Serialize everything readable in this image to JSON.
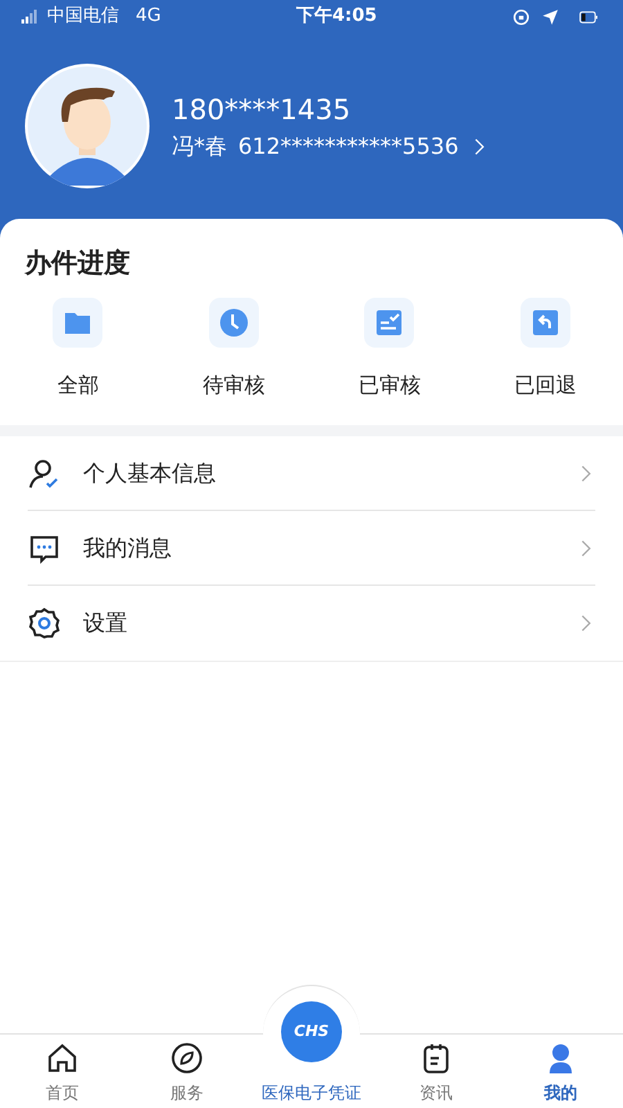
{
  "status_bar": {
    "carrier": "中国电信",
    "network": "4G",
    "time": "下午4:05"
  },
  "profile": {
    "phone": "180****1435",
    "name": "冯*春",
    "id_number": "612***********5536"
  },
  "progress": {
    "title": "办件进度",
    "items": [
      {
        "label": "全部",
        "kind": "folder"
      },
      {
        "label": "待审核",
        "kind": "clock"
      },
      {
        "label": "已审核",
        "kind": "checked"
      },
      {
        "label": "已回退",
        "kind": "return"
      }
    ]
  },
  "menu": [
    {
      "label": "个人基本信息",
      "kind": "person"
    },
    {
      "label": "我的消息",
      "kind": "message"
    },
    {
      "label": "设置",
      "kind": "gear"
    }
  ],
  "tab_bar": [
    {
      "label": "首页",
      "kind": "home",
      "selected": false
    },
    {
      "label": "服务",
      "kind": "compass",
      "selected": false
    },
    {
      "label": "医保电子凭证",
      "kind": "center",
      "logo_text": "CHS",
      "selected": false
    },
    {
      "label": "资讯",
      "kind": "news",
      "selected": false
    },
    {
      "label": "我的",
      "kind": "me",
      "selected": true
    }
  ]
}
